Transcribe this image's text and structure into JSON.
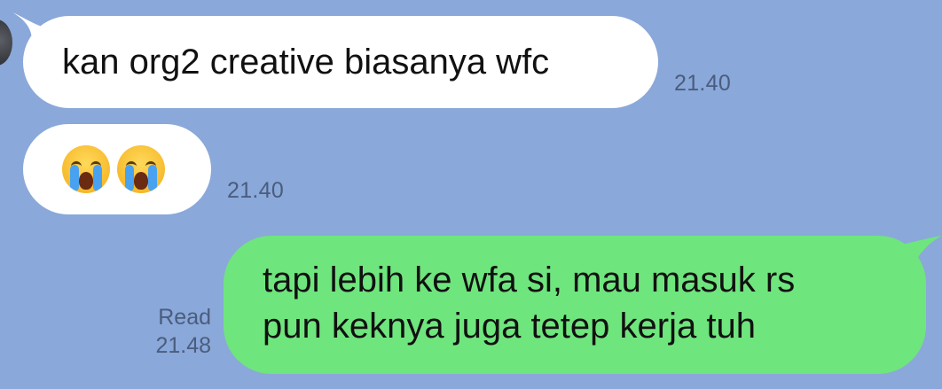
{
  "messages": [
    {
      "side": "incoming",
      "text": "kan org2 creative biasanya wfc",
      "time": "21.40"
    },
    {
      "side": "incoming",
      "emojis": [
        "loudly-crying-face",
        "loudly-crying-face"
      ],
      "time": "21.40"
    },
    {
      "side": "outgoing",
      "lines": [
        "tapi lebih ke wfa si, mau masuk rs",
        "pun keknya juga tetep kerja tuh"
      ],
      "status": "Read",
      "time": "21.48"
    }
  ],
  "colors": {
    "background": "#8aa8d9",
    "incoming_bubble": "#ffffff",
    "outgoing_bubble": "#6fe57d",
    "meta_text": "#4a5d7e"
  }
}
